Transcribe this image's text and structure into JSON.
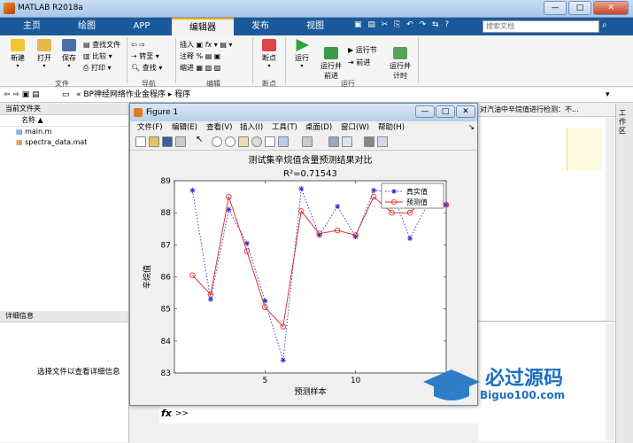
{
  "window": {
    "title": "MATLAB R2018a",
    "min": "—",
    "max": "□",
    "close": "✕"
  },
  "tabs": [
    "主页",
    "绘图",
    "APP",
    "编辑器",
    "发布",
    "视图"
  ],
  "search": {
    "placeholder": "搜索文档"
  },
  "ribbon": {
    "new": "新建",
    "open": "打开",
    "save": "保存",
    "find_files": "查找文件",
    "compare": "比较",
    "print": "打印",
    "goto": "转至",
    "find": "查找",
    "insert": "插入",
    "comment": "注释",
    "indent": "缩进",
    "fx": "fx",
    "breakpoints": "断点",
    "run": "运行",
    "run_advance": "运行并\n前进",
    "run_section": "运行节",
    "advance": "前进",
    "run_time": "运行并\n计时",
    "groups": {
      "file": "文件",
      "navigate": "导航",
      "edit": "编辑",
      "breakpoints": "断点",
      "run": "运行"
    }
  },
  "address": {
    "path1": "BP神经网络作业金程序",
    "sep": "▸",
    "path2": "程序"
  },
  "current_folder": {
    "title": "当前文件夹",
    "name_col": "名称",
    "sort_indicator": "▲",
    "files": [
      "main.m",
      "spectra_data.mat"
    ]
  },
  "details": {
    "title": "详细信息",
    "hint": "选择文件以查看详细信息"
  },
  "editor_snippet": "对汽油中辛烷值进行检测：不...",
  "workspace_label": "工作区",
  "figure": {
    "title": "Figure 1",
    "menu": [
      "文件(F)",
      "编辑(E)",
      "查看(V)",
      "插入(I)",
      "工具(T)",
      "桌面(D)",
      "窗口(W)",
      "帮助(H)"
    ]
  },
  "chart_data": {
    "type": "line",
    "title": "测试集辛烷值含量预测结果对比",
    "subtitle": "R²=0.71543",
    "xlabel": "预测样本",
    "ylabel": "辛烷值",
    "xlim": [
      0,
      15
    ],
    "ylim": [
      83,
      89
    ],
    "xticks": [
      0,
      5,
      10
    ],
    "yticks": [
      83,
      84,
      85,
      86,
      87,
      88,
      89
    ],
    "x": [
      1,
      2,
      3,
      4,
      5,
      6,
      7,
      8,
      9,
      10,
      11,
      12,
      13,
      14,
      15
    ],
    "series": [
      {
        "name": "真实值",
        "color": "#2b2bd6",
        "marker": "*",
        "dash": "dotted",
        "values": [
          88.7,
          85.3,
          88.1,
          87.05,
          85.25,
          83.4,
          88.75,
          87.3,
          88.2,
          87.25,
          88.7,
          88.65,
          87.2,
          88.3,
          88.25
        ]
      },
      {
        "name": "预测值",
        "color": "#e02020",
        "marker": "o",
        "dash": "solid",
        "values": [
          86.05,
          85.45,
          88.5,
          86.8,
          85.05,
          84.45,
          88.05,
          87.35,
          87.45,
          87.3,
          88.5,
          88.0,
          88.0,
          88.6,
          88.25
        ]
      }
    ],
    "legend_position": "top-right",
    "grid": false
  },
  "cmd": {
    "prompt": "fx",
    "caret": ">>"
  },
  "logo": {
    "cn": "必过源码",
    "url": "Biguo100.com"
  }
}
